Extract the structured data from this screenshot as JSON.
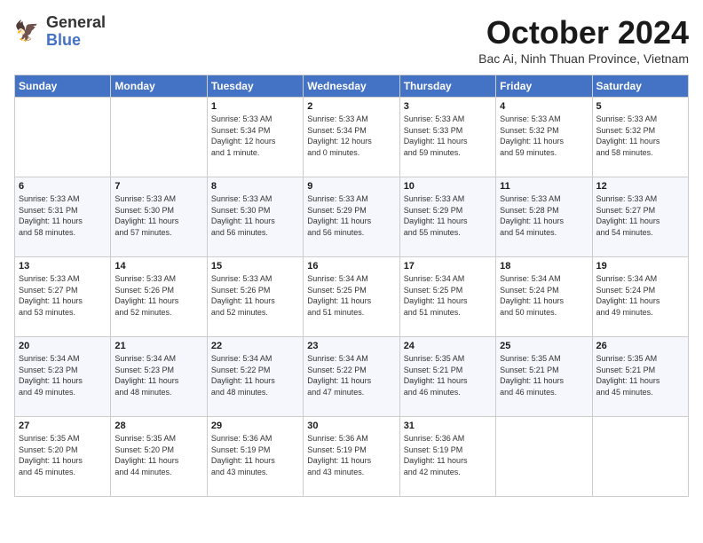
{
  "header": {
    "logo_line1": "General",
    "logo_line2": "Blue",
    "month_title": "October 2024",
    "subtitle": "Bac Ai, Ninh Thuan Province, Vietnam"
  },
  "weekdays": [
    "Sunday",
    "Monday",
    "Tuesday",
    "Wednesday",
    "Thursday",
    "Friday",
    "Saturday"
  ],
  "weeks": [
    [
      {
        "day": "",
        "info": ""
      },
      {
        "day": "",
        "info": ""
      },
      {
        "day": "1",
        "info": "Sunrise: 5:33 AM\nSunset: 5:34 PM\nDaylight: 12 hours\nand 1 minute."
      },
      {
        "day": "2",
        "info": "Sunrise: 5:33 AM\nSunset: 5:34 PM\nDaylight: 12 hours\nand 0 minutes."
      },
      {
        "day": "3",
        "info": "Sunrise: 5:33 AM\nSunset: 5:33 PM\nDaylight: 11 hours\nand 59 minutes."
      },
      {
        "day": "4",
        "info": "Sunrise: 5:33 AM\nSunset: 5:32 PM\nDaylight: 11 hours\nand 59 minutes."
      },
      {
        "day": "5",
        "info": "Sunrise: 5:33 AM\nSunset: 5:32 PM\nDaylight: 11 hours\nand 58 minutes."
      }
    ],
    [
      {
        "day": "6",
        "info": "Sunrise: 5:33 AM\nSunset: 5:31 PM\nDaylight: 11 hours\nand 58 minutes."
      },
      {
        "day": "7",
        "info": "Sunrise: 5:33 AM\nSunset: 5:30 PM\nDaylight: 11 hours\nand 57 minutes."
      },
      {
        "day": "8",
        "info": "Sunrise: 5:33 AM\nSunset: 5:30 PM\nDaylight: 11 hours\nand 56 minutes."
      },
      {
        "day": "9",
        "info": "Sunrise: 5:33 AM\nSunset: 5:29 PM\nDaylight: 11 hours\nand 56 minutes."
      },
      {
        "day": "10",
        "info": "Sunrise: 5:33 AM\nSunset: 5:29 PM\nDaylight: 11 hours\nand 55 minutes."
      },
      {
        "day": "11",
        "info": "Sunrise: 5:33 AM\nSunset: 5:28 PM\nDaylight: 11 hours\nand 54 minutes."
      },
      {
        "day": "12",
        "info": "Sunrise: 5:33 AM\nSunset: 5:27 PM\nDaylight: 11 hours\nand 54 minutes."
      }
    ],
    [
      {
        "day": "13",
        "info": "Sunrise: 5:33 AM\nSunset: 5:27 PM\nDaylight: 11 hours\nand 53 minutes."
      },
      {
        "day": "14",
        "info": "Sunrise: 5:33 AM\nSunset: 5:26 PM\nDaylight: 11 hours\nand 52 minutes."
      },
      {
        "day": "15",
        "info": "Sunrise: 5:33 AM\nSunset: 5:26 PM\nDaylight: 11 hours\nand 52 minutes."
      },
      {
        "day": "16",
        "info": "Sunrise: 5:34 AM\nSunset: 5:25 PM\nDaylight: 11 hours\nand 51 minutes."
      },
      {
        "day": "17",
        "info": "Sunrise: 5:34 AM\nSunset: 5:25 PM\nDaylight: 11 hours\nand 51 minutes."
      },
      {
        "day": "18",
        "info": "Sunrise: 5:34 AM\nSunset: 5:24 PM\nDaylight: 11 hours\nand 50 minutes."
      },
      {
        "day": "19",
        "info": "Sunrise: 5:34 AM\nSunset: 5:24 PM\nDaylight: 11 hours\nand 49 minutes."
      }
    ],
    [
      {
        "day": "20",
        "info": "Sunrise: 5:34 AM\nSunset: 5:23 PM\nDaylight: 11 hours\nand 49 minutes."
      },
      {
        "day": "21",
        "info": "Sunrise: 5:34 AM\nSunset: 5:23 PM\nDaylight: 11 hours\nand 48 minutes."
      },
      {
        "day": "22",
        "info": "Sunrise: 5:34 AM\nSunset: 5:22 PM\nDaylight: 11 hours\nand 48 minutes."
      },
      {
        "day": "23",
        "info": "Sunrise: 5:34 AM\nSunset: 5:22 PM\nDaylight: 11 hours\nand 47 minutes."
      },
      {
        "day": "24",
        "info": "Sunrise: 5:35 AM\nSunset: 5:21 PM\nDaylight: 11 hours\nand 46 minutes."
      },
      {
        "day": "25",
        "info": "Sunrise: 5:35 AM\nSunset: 5:21 PM\nDaylight: 11 hours\nand 46 minutes."
      },
      {
        "day": "26",
        "info": "Sunrise: 5:35 AM\nSunset: 5:21 PM\nDaylight: 11 hours\nand 45 minutes."
      }
    ],
    [
      {
        "day": "27",
        "info": "Sunrise: 5:35 AM\nSunset: 5:20 PM\nDaylight: 11 hours\nand 45 minutes."
      },
      {
        "day": "28",
        "info": "Sunrise: 5:35 AM\nSunset: 5:20 PM\nDaylight: 11 hours\nand 44 minutes."
      },
      {
        "day": "29",
        "info": "Sunrise: 5:36 AM\nSunset: 5:19 PM\nDaylight: 11 hours\nand 43 minutes."
      },
      {
        "day": "30",
        "info": "Sunrise: 5:36 AM\nSunset: 5:19 PM\nDaylight: 11 hours\nand 43 minutes."
      },
      {
        "day": "31",
        "info": "Sunrise: 5:36 AM\nSunset: 5:19 PM\nDaylight: 11 hours\nand 42 minutes."
      },
      {
        "day": "",
        "info": ""
      },
      {
        "day": "",
        "info": ""
      }
    ]
  ]
}
